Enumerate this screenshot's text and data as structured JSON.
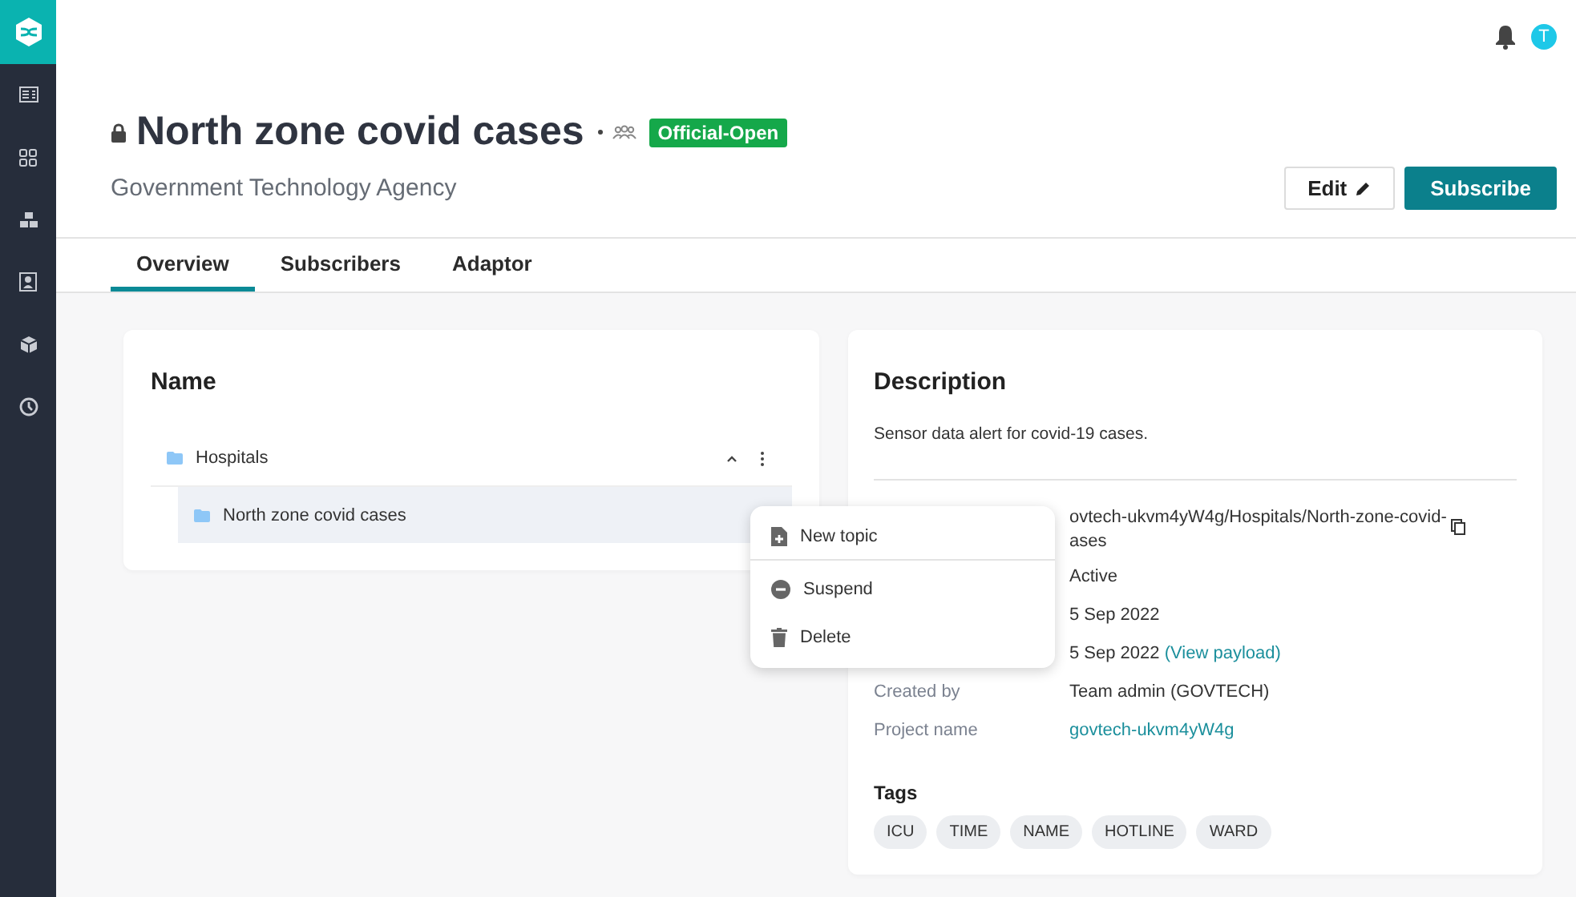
{
  "header": {
    "title": "North zone covid cases",
    "badge": "Official-Open",
    "organization": "Government Technology Agency"
  },
  "top_bar": {
    "avatar_initial": "T"
  },
  "buttons": [
    {
      "label": "Edit",
      "kind": "secondary"
    },
    {
      "label": "Subscribe",
      "kind": "primary"
    }
  ],
  "tabs": [
    {
      "label": "Overview",
      "selected": true
    },
    {
      "label": "Subscribers",
      "selected": false
    },
    {
      "label": "Adaptor",
      "selected": false
    }
  ],
  "name_card": {
    "title": "Name",
    "tree": [
      {
        "label": "Hospitals",
        "expanded": true,
        "selected": false,
        "children": [
          {
            "label": "North zone covid cases",
            "selected": true
          }
        ]
      }
    ]
  },
  "context_menu": [
    {
      "label": "New topic",
      "kind": "new",
      "separator_after": true
    },
    {
      "label": "Suspend",
      "kind": "suspend",
      "separator_after": false
    },
    {
      "label": "Delete",
      "kind": "delete",
      "separator_after": false
    }
  ],
  "description_card": {
    "title": "Description",
    "text": "Sensor data alert for covid-19 cases.",
    "details": [
      {
        "value_lines": [
          "ovtech-ukvm4yW4g/Hospitals/North-zone-covid-",
          "ases"
        ],
        "copyable": true
      },
      {
        "value_lines": [
          "Active"
        ]
      },
      {
        "value_lines": [
          "5 Sep 2022"
        ]
      },
      {
        "value_lines": [
          "5 Sep 2022"
        ],
        "link": "(View payload)"
      },
      {
        "label": "Created by",
        "value_lines": [
          "Team admin (GOVTECH)"
        ]
      },
      {
        "label": "Project name",
        "link": "govtech-ukvm4yW4g"
      }
    ],
    "tags_title": "Tags",
    "tags": [
      "ICU",
      "TIME",
      "NAME",
      "HOTLINE",
      "WARD"
    ]
  }
}
